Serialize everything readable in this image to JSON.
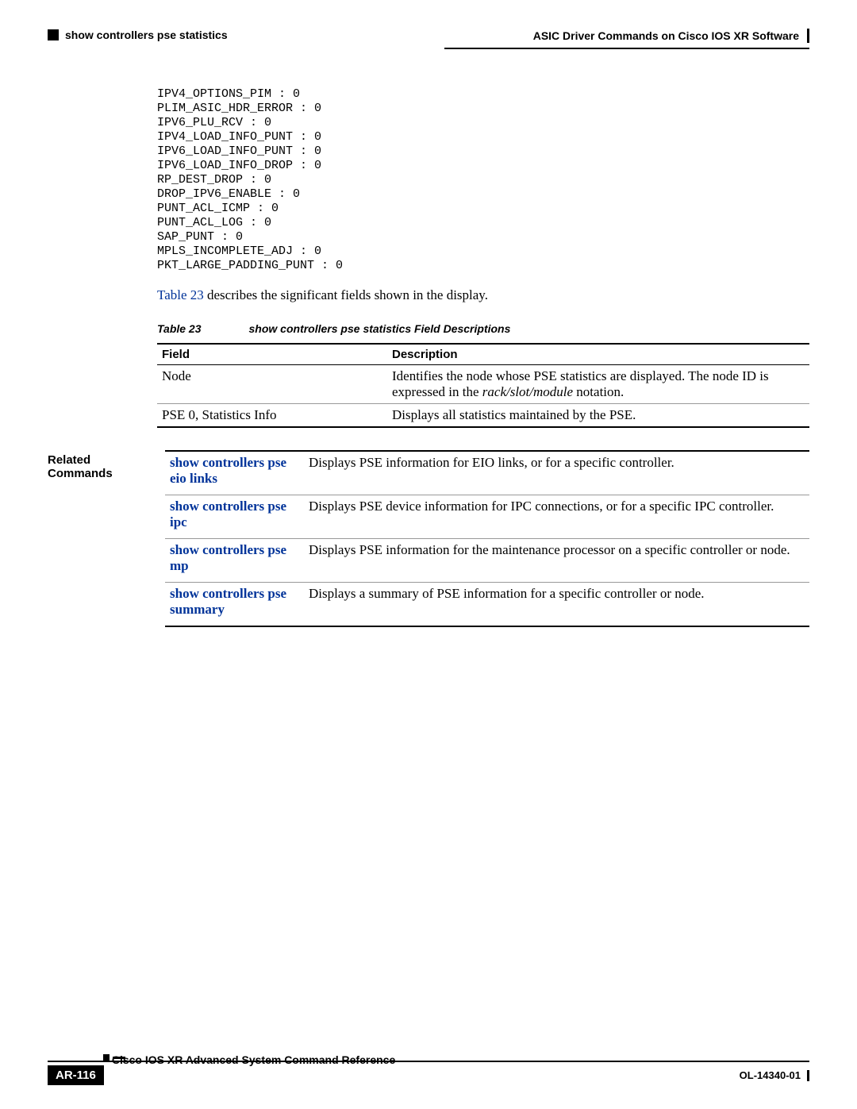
{
  "header": {
    "left_label": "show controllers pse statistics",
    "right_label": "ASIC Driver Commands on Cisco IOS XR Software"
  },
  "code_output": "IPV4_OPTIONS_PIM : 0\nPLIM_ASIC_HDR_ERROR : 0\nIPV6_PLU_RCV : 0\nIPV4_LOAD_INFO_PUNT : 0\nIPV6_LOAD_INFO_PUNT : 0\nIPV6_LOAD_INFO_DROP : 0\nRP_DEST_DROP : 0\nDROP_IPV6_ENABLE : 0\nPUNT_ACL_ICMP : 0\nPUNT_ACL_LOG : 0\nSAP_PUNT : 0\nMPLS_INCOMPLETE_ADJ : 0\nPKT_LARGE_PADDING_PUNT : 0",
  "body_sentence": {
    "ref": "Table 23",
    "rest": " describes the significant fields shown in the display."
  },
  "table_caption": {
    "label": "Table 23",
    "title": "show controllers pse statistics Field Descriptions"
  },
  "field_table": {
    "col1": "Field",
    "col2": "Description",
    "rows": [
      {
        "field": "Node",
        "desc_pre": "Identifies the node whose PSE statistics are displayed. The node ID is expressed in the ",
        "desc_italic": "rack/slot/module",
        "desc_post": " notation."
      },
      {
        "field": "PSE 0, Statistics Info",
        "desc_pre": "Displays all statistics maintained by the PSE.",
        "desc_italic": "",
        "desc_post": ""
      }
    ]
  },
  "related": {
    "label": "Related Commands",
    "rows": [
      {
        "cmd": "show controllers pse eio links",
        "desc": "Displays PSE information for EIO links, or for a specific controller."
      },
      {
        "cmd": "show controllers pse ipc",
        "desc": "Displays PSE device information for IPC connections, or for a specific IPC controller."
      },
      {
        "cmd": "show controllers pse mp",
        "desc": "Displays PSE information for the maintenance processor on a specific controller or node."
      },
      {
        "cmd": "show controllers pse summary",
        "desc": "Displays a summary of PSE information for a specific controller or node."
      }
    ]
  },
  "footer": {
    "book_title": "Cisco IOS XR Advanced System Command Reference",
    "page_number": "AR-116",
    "doc_id": "OL-14340-01"
  }
}
